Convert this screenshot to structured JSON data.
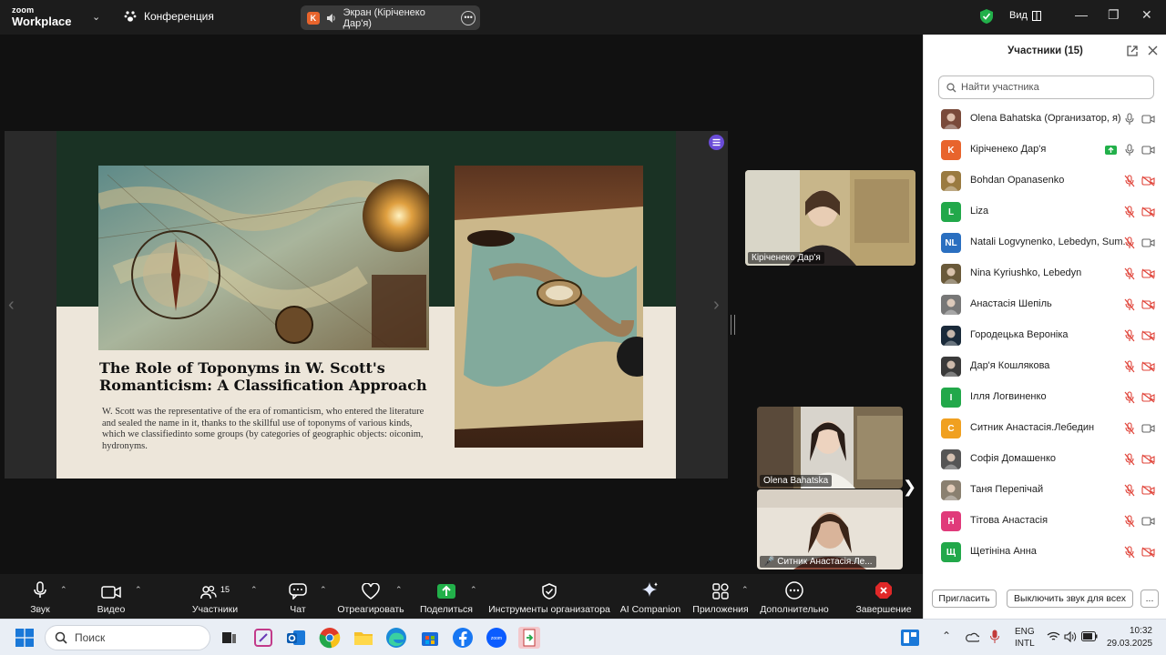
{
  "app": {
    "logo_top": "zoom",
    "logo_bottom": "Workplace",
    "meeting_title": "Конференция",
    "screen_share_label": "Экран (Кіріченеко Дар'я)",
    "screen_share_badge": "K",
    "view_label": "Вид",
    "accent_color": "#0e71eb"
  },
  "slide": {
    "title": "The Role of Toponyms in W. Scott's Romanticism: A Classification Approach",
    "body": "W. Scott was the representative of the era of romanticism, who entered the literature and sealed the name in it, thanks to the skillful use of toponyms of various kinds, which we classifiedinto  some groups (by categories of geographic objects: oiconim, hydronyms."
  },
  "video_tiles": [
    {
      "name": "Кіріченеко Дар'я"
    },
    {
      "name": "Olena Bahatska"
    },
    {
      "name": "Ситник Анастасія.Ле..."
    }
  ],
  "toolbar": {
    "audio": "Звук",
    "video": "Видео",
    "participants": "Участники",
    "participants_count": "15",
    "chat": "Чат",
    "react": "Отреагировать",
    "share": "Поделиться",
    "host_tools": "Инструменты организатора",
    "ai": "AI Companion",
    "apps": "Приложения",
    "more": "Дополнительно",
    "end": "Завершение"
  },
  "panel": {
    "title": "Участники (15)",
    "search_placeholder": "Найти участника",
    "invite": "Пригласить",
    "mute_all": "Выключить звук для всех",
    "more": "..."
  },
  "participants": [
    {
      "name": "Olena Bahatska (Организатор, я)",
      "initials": "",
      "color": "#7a4a3a",
      "mic": "on",
      "cam": "on"
    },
    {
      "name": "Кіріченеко Дар'я",
      "initials": "K",
      "color": "#e8642c",
      "mic": "on",
      "cam": "on",
      "sharing": true
    },
    {
      "name": "Bohdan Opanasenko",
      "initials": "",
      "color": "#9a7a40",
      "mic": "off",
      "cam": "off"
    },
    {
      "name": "Liza",
      "initials": "L",
      "color": "#22a84a",
      "mic": "off",
      "cam": "off"
    },
    {
      "name": "Natali Logvynenko, Lebedyn, Sum...",
      "initials": "NL",
      "color": "#2a6fc0",
      "mic": "off",
      "cam": "on"
    },
    {
      "name": "Nina Kyriushko, Lebedyn",
      "initials": "",
      "color": "#6a5a3a",
      "mic": "off",
      "cam": "off"
    },
    {
      "name": "Анастасія Шепіль",
      "initials": "",
      "color": "#777777",
      "mic": "off",
      "cam": "off"
    },
    {
      "name": "Городецька Вероніка",
      "initials": "",
      "color": "#1a2a3a",
      "mic": "off",
      "cam": "off"
    },
    {
      "name": "Дар'я Кошлякова",
      "initials": "",
      "color": "#3a3a3a",
      "mic": "off",
      "cam": "off"
    },
    {
      "name": "Ілля Логвиненко",
      "initials": "I",
      "color": "#22a84a",
      "mic": "off",
      "cam": "off"
    },
    {
      "name": "Ситник Анастасія.Лебедин",
      "initials": "C",
      "color": "#f0a020",
      "mic": "off",
      "cam": "on"
    },
    {
      "name": "Софія Домашенко",
      "initials": "",
      "color": "#555555",
      "mic": "off",
      "cam": "off"
    },
    {
      "name": "Таня Перепічай",
      "initials": "",
      "color": "#8a8070",
      "mic": "off",
      "cam": "off"
    },
    {
      "name": "Тітова Анастасія",
      "initials": "H",
      "color": "#e03a7a",
      "mic": "off",
      "cam": "on"
    },
    {
      "name": "Щетініна Анна",
      "initials": "Щ",
      "color": "#22a84a",
      "mic": "off",
      "cam": "off"
    }
  ],
  "taskbar": {
    "search": "Поиск",
    "lang_top": "ENG",
    "lang_bottom": "INTL",
    "time": "10:32",
    "date": "29.03.2025"
  }
}
